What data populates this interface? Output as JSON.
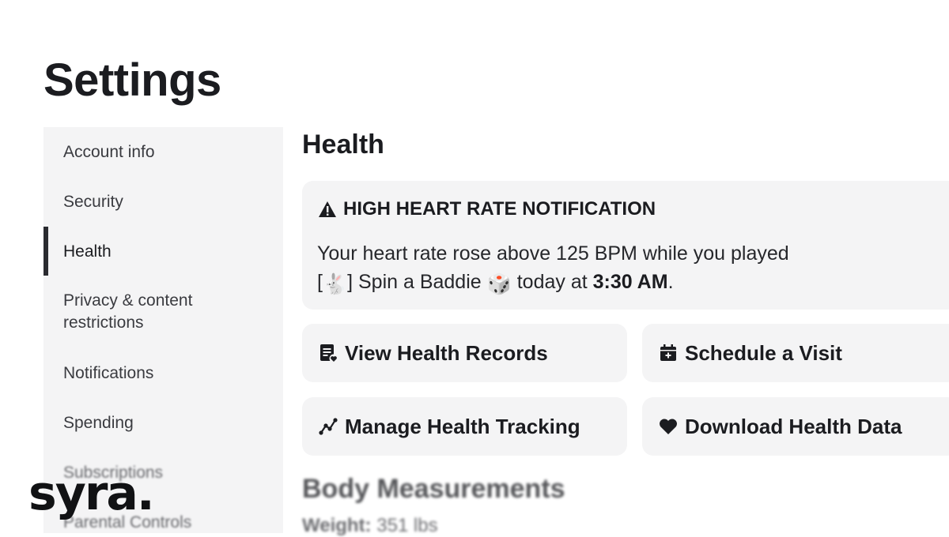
{
  "page": {
    "title": "Settings"
  },
  "sidebar": {
    "items": [
      {
        "label": "Account info"
      },
      {
        "label": "Security"
      },
      {
        "label": "Health",
        "active": true
      },
      {
        "label": "Privacy & content restrictions"
      },
      {
        "label": "Notifications"
      },
      {
        "label": "Spending"
      },
      {
        "label": "Subscriptions"
      },
      {
        "label": "Parental Controls"
      }
    ]
  },
  "main": {
    "section_title": "Health",
    "alert": {
      "icon": "warning-icon",
      "title": "HIGH HEART RATE NOTIFICATION",
      "line1": "Your heart rate rose above 125 BPM while you played",
      "game_prefix": "[",
      "game_rabbit_emoji": "🐇",
      "game_suffix": "] Spin a Baddie",
      "game_dice_emoji": "🎲",
      "today_text": "today at",
      "time": "3:30 AM",
      "end": "."
    },
    "actions": [
      {
        "label": "View Health Records",
        "icon": "health-record-icon"
      },
      {
        "label": "Schedule a Visit",
        "icon": "calendar-icon"
      },
      {
        "label": "Manage Health Tracking",
        "icon": "tracking-chart-icon"
      },
      {
        "label": "Download Health Data",
        "icon": "heart-icon"
      }
    ],
    "body_measurements": {
      "title": "Body Measurements",
      "weight_label": "Weight:",
      "weight_value": "351 lbs"
    }
  },
  "brand": {
    "logo_text": "syra."
  },
  "colors": {
    "card_bg": "#f4f4f5",
    "text": "#1b1c20",
    "active_bar": "#2a2b30"
  }
}
